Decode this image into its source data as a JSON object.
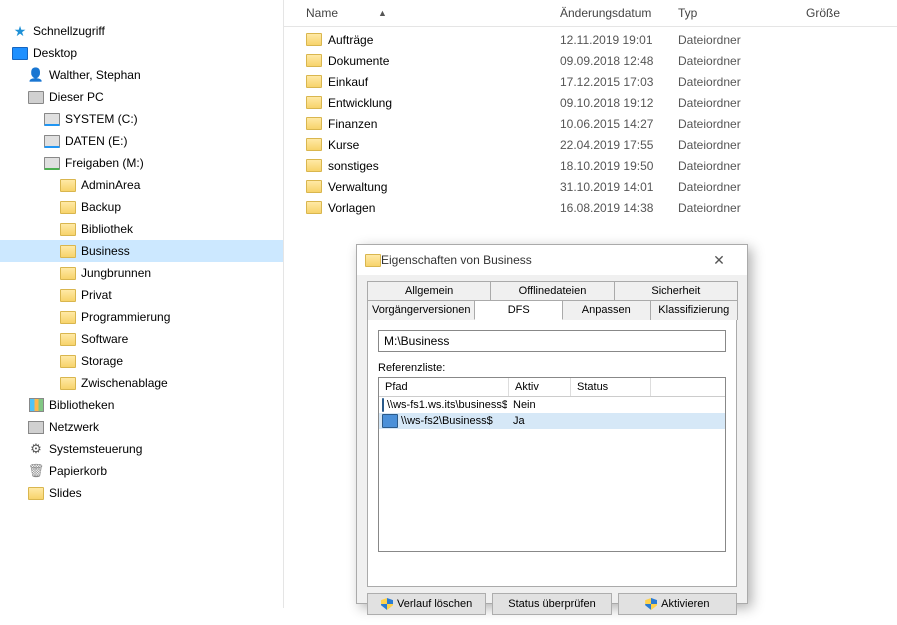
{
  "tree": [
    {
      "level": 0,
      "icon": "star",
      "label": "Schnellzugriff"
    },
    {
      "level": 0,
      "icon": "desktop",
      "label": "Desktop"
    },
    {
      "level": 1,
      "icon": "user",
      "label": "Walther, Stephan"
    },
    {
      "level": 1,
      "icon": "pc",
      "label": "Dieser PC"
    },
    {
      "level": 2,
      "icon": "drive",
      "label": "SYSTEM (C:)"
    },
    {
      "level": 2,
      "icon": "drive",
      "label": "DATEN (E:)"
    },
    {
      "level": 2,
      "icon": "drive-net",
      "label": "Freigaben (M:)"
    },
    {
      "level": 3,
      "icon": "folder-share",
      "label": "AdminArea"
    },
    {
      "level": 3,
      "icon": "folder",
      "label": "Backup"
    },
    {
      "level": 3,
      "icon": "folder-share",
      "label": "Bibliothek"
    },
    {
      "level": 3,
      "icon": "folder-share",
      "label": "Business",
      "selected": true
    },
    {
      "level": 3,
      "icon": "folder-share",
      "label": "Jungbrunnen"
    },
    {
      "level": 3,
      "icon": "folder",
      "label": "Privat"
    },
    {
      "level": 3,
      "icon": "folder-share",
      "label": "Programmierung"
    },
    {
      "level": 3,
      "icon": "folder",
      "label": "Software"
    },
    {
      "level": 3,
      "icon": "folder",
      "label": "Storage"
    },
    {
      "level": 3,
      "icon": "folder",
      "label": "Zwischenablage"
    },
    {
      "level": 1,
      "icon": "lib",
      "label": "Bibliotheken"
    },
    {
      "level": 1,
      "icon": "net",
      "label": "Netzwerk"
    },
    {
      "level": 1,
      "icon": "gear",
      "label": "Systemsteuerung"
    },
    {
      "level": 1,
      "icon": "trash",
      "label": "Papierkorb"
    },
    {
      "level": 1,
      "icon": "folder",
      "label": "Slides"
    }
  ],
  "columns": {
    "name": "Name",
    "date": "Änderungsdatum",
    "type": "Typ",
    "size": "Größe"
  },
  "files": [
    {
      "name": "Aufträge",
      "date": "12.11.2019 19:01",
      "type": "Dateiordner"
    },
    {
      "name": "Dokumente",
      "date": "09.09.2018 12:48",
      "type": "Dateiordner"
    },
    {
      "name": "Einkauf",
      "date": "17.12.2015 17:03",
      "type": "Dateiordner"
    },
    {
      "name": "Entwicklung",
      "date": "09.10.2018 19:12",
      "type": "Dateiordner"
    },
    {
      "name": "Finanzen",
      "date": "10.06.2015 14:27",
      "type": "Dateiordner"
    },
    {
      "name": "Kurse",
      "date": "22.04.2019 17:55",
      "type": "Dateiordner"
    },
    {
      "name": "sonstiges",
      "date": "18.10.2019 19:50",
      "type": "Dateiordner"
    },
    {
      "name": "Verwaltung",
      "date": "31.10.2019 14:01",
      "type": "Dateiordner"
    },
    {
      "name": "Vorlagen",
      "date": "16.08.2019 14:38",
      "type": "Dateiordner"
    }
  ],
  "dialog": {
    "title": "Eigenschaften von Business",
    "tabs_row1": [
      "Allgemein",
      "Offlinedateien",
      "Sicherheit"
    ],
    "tabs_row2": [
      "Vorgängerversionen",
      "DFS",
      "Anpassen",
      "Klassifizierung"
    ],
    "active_tab": "DFS",
    "path_value": "M:\\Business",
    "ref_label": "Referenzliste:",
    "ref_head": {
      "pfad": "Pfad",
      "aktiv": "Aktiv",
      "status": "Status"
    },
    "refs": [
      {
        "pfad": "\\\\ws-fs1.ws.its\\business$",
        "aktiv": "Nein",
        "status": "",
        "active": false
      },
      {
        "pfad": "\\\\ws-fs2\\Business$",
        "aktiv": "Ja",
        "status": "",
        "active": true
      }
    ],
    "buttons": {
      "clear": "Verlauf löschen",
      "check": "Status überprüfen",
      "activate": "Aktivieren"
    }
  }
}
